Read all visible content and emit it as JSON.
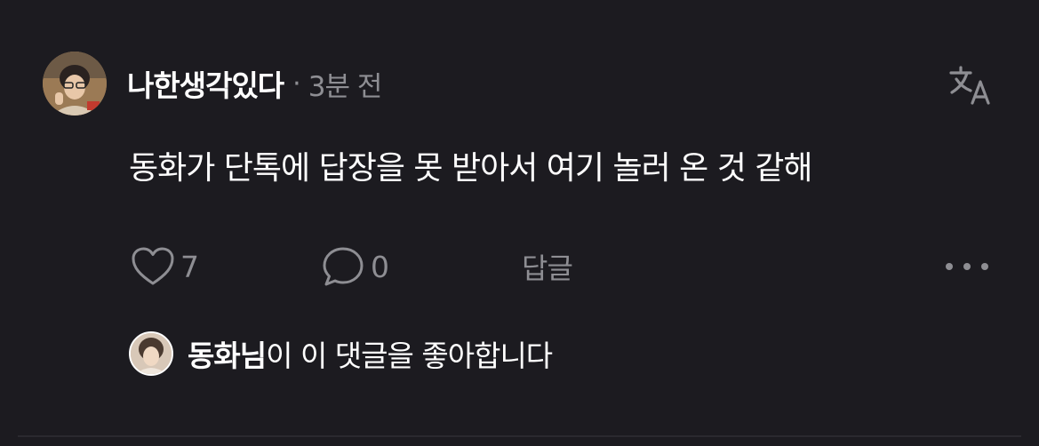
{
  "comment": {
    "username": "나한생각있다",
    "separator": "·",
    "time": "3분 전",
    "text": "동화가 단톡에 답장을 못 받아서 여기 놀러 온 것 같해",
    "avatar_icon": "user-avatar-photo",
    "translate_icon": "translate-icon"
  },
  "actions": {
    "like_icon": "heart-icon",
    "like_count": "7",
    "comment_icon": "comment-bubble-icon",
    "comment_count": "0",
    "reply_label": "답글",
    "more_icon": "more-horizontal-icon"
  },
  "liked_by": {
    "name": "동화님",
    "text": "이 이 댓글을 좋아합니다"
  },
  "colors": {
    "background": "#1c1b20",
    "text_primary": "#ffffff",
    "text_secondary": "#8e8e93"
  }
}
